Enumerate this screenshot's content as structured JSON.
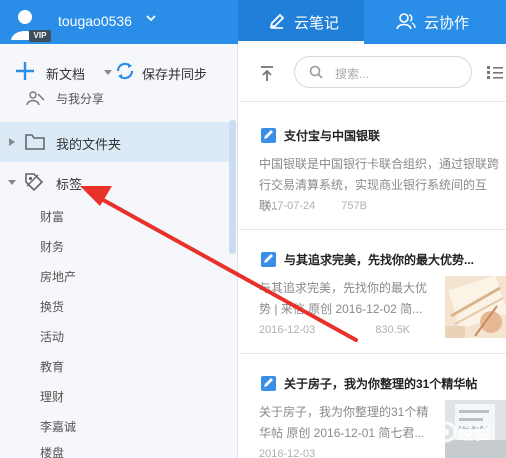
{
  "header": {
    "username": "tougao0536",
    "vip_badge": "VIP",
    "tabs": [
      {
        "label": "云笔记",
        "active": true
      },
      {
        "label": "云协作",
        "active": false
      }
    ],
    "bg_color": "#2a8ee8"
  },
  "sidebar": {
    "new_doc_label": "新文档",
    "sync_label": "保存并同步",
    "shared_label": "与我分享",
    "folder_label": "我的文件夹",
    "tags_label": "标签",
    "tags": [
      "财富",
      "财务",
      "房地产",
      "换货",
      "活动",
      "教育",
      "理财",
      "李嘉诚",
      "楼盘"
    ]
  },
  "main": {
    "search_placeholder": "搜索...",
    "notes": [
      {
        "title": "支付宝与中国银联",
        "snippet_lines": [
          "中国银联是中国银行卡联合组织，通过银联跨",
          "行交易清算系统，实现商业银行系统间的互联..."
        ],
        "date": "2017-07-24",
        "size": "757B",
        "has_thumbnail": false
      },
      {
        "title": "与其追求完美，先找你的最大优势...",
        "snippet_lines": [
          "与其追求完美，先找你的最大优",
          "势 | 来信 原创 2016-12-02 简..."
        ],
        "date": "2016-12-03",
        "size": "830.5K",
        "has_thumbnail": true
      },
      {
        "title": "关于房子，我为你整理的31个精华帖",
        "snippet_lines": [
          "关于房子，我为你整理的31个精",
          "华帖 原创 2016-12-01 简七君..."
        ],
        "date": "2016-12-03",
        "size": "",
        "has_thumbnail": true
      }
    ]
  },
  "annotation": {
    "color": "#e8312a"
  },
  "watermark_text": "经验"
}
